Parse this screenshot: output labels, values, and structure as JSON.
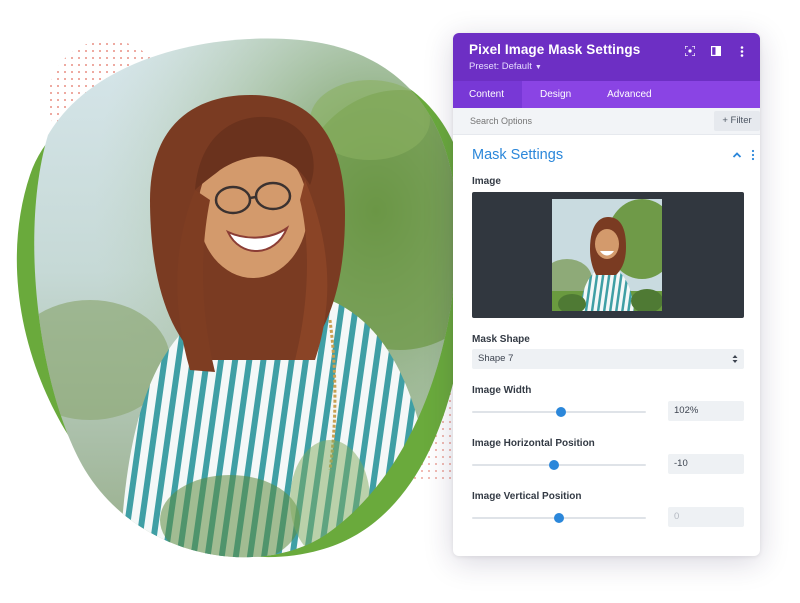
{
  "panel": {
    "title": "Pixel Image Mask Settings",
    "preset": "Preset: Default",
    "header_icons": [
      "focus-icon",
      "sidebar-layout-icon",
      "more-vertical-icon"
    ],
    "tabs": [
      {
        "label": "Content",
        "active": true
      },
      {
        "label": "Design",
        "active": false
      },
      {
        "label": "Advanced",
        "active": false
      }
    ],
    "search": {
      "placeholder": "Search Options",
      "filter_label": "+ Filter"
    },
    "section": {
      "title": "Mask Settings",
      "expanded": true
    },
    "fields": {
      "image_label": "Image",
      "mask_shape": {
        "label": "Mask Shape",
        "value": "Shape 7"
      },
      "image_width": {
        "label": "Image Width",
        "value": "102%",
        "slider_fraction": 0.51
      },
      "image_horizontal": {
        "label": "Image Horizontal Position",
        "value": "-10",
        "slider_fraction": 0.47
      },
      "image_vertical": {
        "label": "Image Vertical Position",
        "value": "0",
        "slider_fraction": 0.5
      }
    }
  },
  "colors": {
    "header_purple": "#6d2fc4",
    "tab_purple": "#8a44e4",
    "accent_blue": "#2b87da",
    "blob_green": "#6aaa3c",
    "dots_red": "#e06a5a"
  }
}
